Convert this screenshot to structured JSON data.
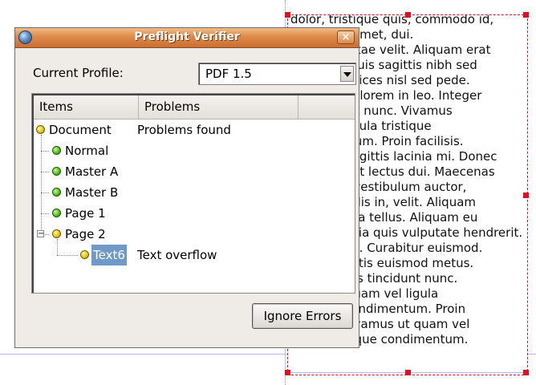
{
  "dialog": {
    "title": "Preflight Verifier",
    "close_icon": "×",
    "current_profile_label": "Current Profile:",
    "profile_value": "PDF 1.5",
    "columns": [
      "Items",
      "Problems",
      ""
    ],
    "tree": {
      "root": {
        "label": "Document",
        "problem": "Problems found",
        "status": "yellow"
      },
      "children": [
        {
          "label": "Normal",
          "problem": "",
          "status": "green"
        },
        {
          "label": "Master A",
          "problem": "",
          "status": "green"
        },
        {
          "label": "Master B",
          "problem": "",
          "status": "green"
        },
        {
          "label": "Page 1",
          "problem": "",
          "status": "green"
        },
        {
          "label": "Page 2",
          "problem": "",
          "status": "yellow",
          "expanded": true,
          "children": [
            {
              "label": "Text6",
              "problem": "Text overflow",
              "status": "yellow",
              "selected": true
            }
          ]
        }
      ]
    },
    "ignore_button": "Ignore Errors"
  },
  "document": {
    "text_lines": [
      "dolor, tristique quis, commodo id,",
      "lorem. Sit amet, dui.",
      "Vivamus vitae velit. Aliquam erat",
      "volutpat. Duis sagittis nibh sed",
      "massa. Ultrices nisl sed pede.",
      "Aliquam ut lorem in leo. Integer",
      "ut tincidunt nunc. Vivamus",
      "ut quam ligula tristique",
      "condimentum. Proin facilisis.",
      "Vivamus sagittis lacinia mi. Donec",
      "quis justo at lectus dui. Maecenas",
      "ac mauris vestibulum auctor,",
      "Donec iaculis in, velit. Aliquam",
      "Morbi nibh a tellus. Aliquam eu",
      "lectus lacinia quis vulputate hendrerit.",
      "Ut euismod. Curabitur euismod.",
      "Morbi lobortis euismod metus.",
      "Morbi mollis tincidunt nunc.",
      "Vivamus quam vel ligula",
      "tristique condimentum. Proin",
      "facilisis. Vivamus ut quam vel",
      "ligula tristique condimentum."
    ]
  },
  "colors": {
    "titlebar": "#dd8a4a",
    "frame_border": "#e0152a",
    "selection": "#6f9ac7",
    "status_ok": "#4fbb1a",
    "status_warn": "#e0c10b"
  }
}
